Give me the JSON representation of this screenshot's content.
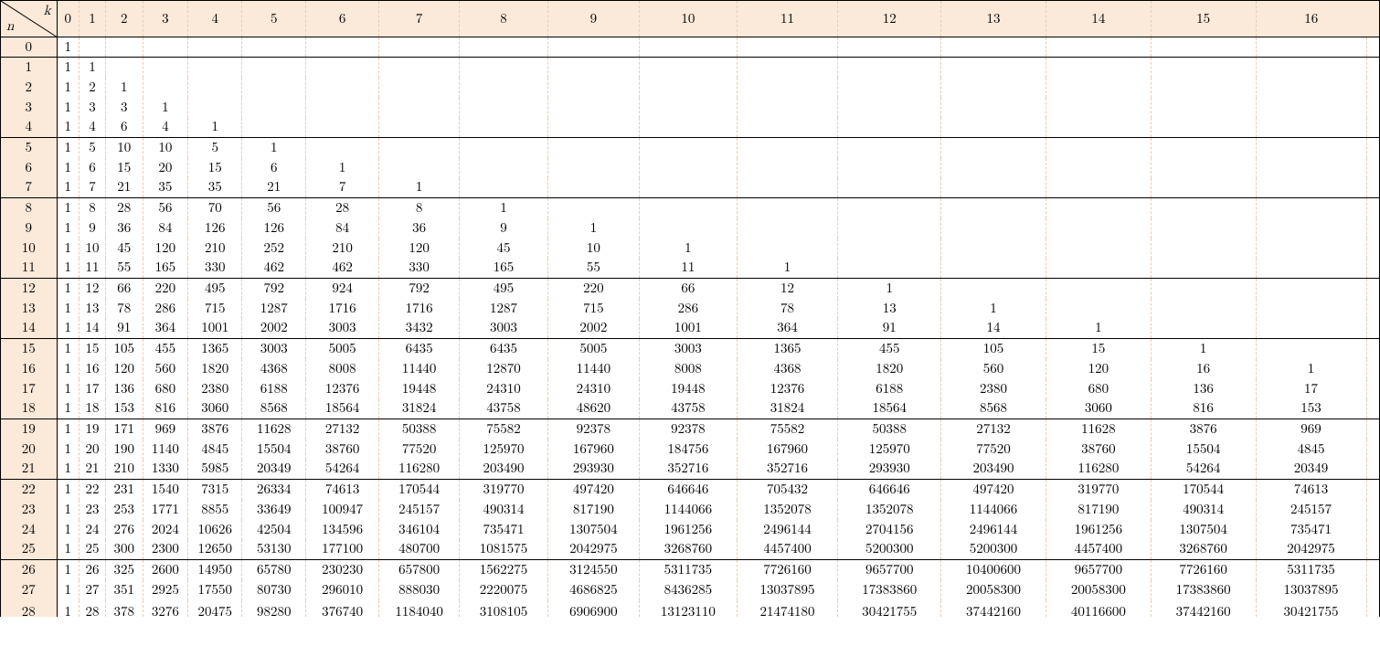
{
  "header": {
    "row_label": "n",
    "col_label": "k",
    "columns": [
      "0",
      "1",
      "2",
      "3",
      "4",
      "5",
      "6",
      "7",
      "8",
      "9",
      "10",
      "11",
      "12",
      "13",
      "14",
      "15",
      "16"
    ]
  },
  "rows": [
    {
      "n": "0",
      "sep": true,
      "cells": [
        "1",
        "",
        "",
        "",
        "",
        "",
        "",
        "",
        "",
        "",
        "",
        "",
        "",
        "",
        "",
        "",
        ""
      ]
    },
    {
      "n": "1",
      "sep": true,
      "cells": [
        "1",
        "1",
        "",
        "",
        "",
        "",
        "",
        "",
        "",
        "",
        "",
        "",
        "",
        "",
        "",
        "",
        ""
      ]
    },
    {
      "n": "2",
      "cells": [
        "1",
        "2",
        "1",
        "",
        "",
        "",
        "",
        "",
        "",
        "",
        "",
        "",
        "",
        "",
        "",
        "",
        ""
      ]
    },
    {
      "n": "3",
      "cells": [
        "1",
        "3",
        "3",
        "1",
        "",
        "",
        "",
        "",
        "",
        "",
        "",
        "",
        "",
        "",
        "",
        "",
        ""
      ]
    },
    {
      "n": "4",
      "cells": [
        "1",
        "4",
        "6",
        "4",
        "1",
        "",
        "",
        "",
        "",
        "",
        "",
        "",
        "",
        "",
        "",
        "",
        ""
      ]
    },
    {
      "n": "5",
      "sep": true,
      "cells": [
        "1",
        "5",
        "10",
        "10",
        "5",
        "1",
        "",
        "",
        "",
        "",
        "",
        "",
        "",
        "",
        "",
        "",
        ""
      ]
    },
    {
      "n": "6",
      "cells": [
        "1",
        "6",
        "15",
        "20",
        "15",
        "6",
        "1",
        "",
        "",
        "",
        "",
        "",
        "",
        "",
        "",
        "",
        ""
      ]
    },
    {
      "n": "7",
      "cells": [
        "1",
        "7",
        "21",
        "35",
        "35",
        "21",
        "7",
        "1",
        "",
        "",
        "",
        "",
        "",
        "",
        "",
        "",
        ""
      ]
    },
    {
      "n": "8",
      "sep": true,
      "cells": [
        "1",
        "8",
        "28",
        "56",
        "70",
        "56",
        "28",
        "8",
        "1",
        "",
        "",
        "",
        "",
        "",
        "",
        "",
        ""
      ]
    },
    {
      "n": "9",
      "cells": [
        "1",
        "9",
        "36",
        "84",
        "126",
        "126",
        "84",
        "36",
        "9",
        "1",
        "",
        "",
        "",
        "",
        "",
        "",
        ""
      ]
    },
    {
      "n": "10",
      "cells": [
        "1",
        "10",
        "45",
        "120",
        "210",
        "252",
        "210",
        "120",
        "45",
        "10",
        "1",
        "",
        "",
        "",
        "",
        "",
        ""
      ]
    },
    {
      "n": "11",
      "cells": [
        "1",
        "11",
        "55",
        "165",
        "330",
        "462",
        "462",
        "330",
        "165",
        "55",
        "11",
        "1",
        "",
        "",
        "",
        "",
        ""
      ]
    },
    {
      "n": "12",
      "sep": true,
      "cells": [
        "1",
        "12",
        "66",
        "220",
        "495",
        "792",
        "924",
        "792",
        "495",
        "220",
        "66",
        "12",
        "1",
        "",
        "",
        "",
        ""
      ]
    },
    {
      "n": "13",
      "cells": [
        "1",
        "13",
        "78",
        "286",
        "715",
        "1287",
        "1716",
        "1716",
        "1287",
        "715",
        "286",
        "78",
        "13",
        "1",
        "",
        "",
        ""
      ]
    },
    {
      "n": "14",
      "cells": [
        "1",
        "14",
        "91",
        "364",
        "1001",
        "2002",
        "3003",
        "3432",
        "3003",
        "2002",
        "1001",
        "364",
        "91",
        "14",
        "1",
        "",
        ""
      ]
    },
    {
      "n": "15",
      "sep": true,
      "cells": [
        "1",
        "15",
        "105",
        "455",
        "1365",
        "3003",
        "5005",
        "6435",
        "6435",
        "5005",
        "3003",
        "1365",
        "455",
        "105",
        "15",
        "1",
        ""
      ]
    },
    {
      "n": "16",
      "cells": [
        "1",
        "16",
        "120",
        "560",
        "1820",
        "4368",
        "8008",
        "11440",
        "12870",
        "11440",
        "8008",
        "4368",
        "1820",
        "560",
        "120",
        "16",
        "1"
      ]
    },
    {
      "n": "17",
      "cells": [
        "1",
        "17",
        "136",
        "680",
        "2380",
        "6188",
        "12376",
        "19448",
        "24310",
        "24310",
        "19448",
        "12376",
        "6188",
        "2380",
        "680",
        "136",
        "17"
      ]
    },
    {
      "n": "18",
      "cells": [
        "1",
        "18",
        "153",
        "816",
        "3060",
        "8568",
        "18564",
        "31824",
        "43758",
        "48620",
        "43758",
        "31824",
        "18564",
        "8568",
        "3060",
        "816",
        "153"
      ]
    },
    {
      "n": "19",
      "sep": true,
      "cells": [
        "1",
        "19",
        "171",
        "969",
        "3876",
        "11628",
        "27132",
        "50388",
        "75582",
        "92378",
        "92378",
        "75582",
        "50388",
        "27132",
        "11628",
        "3876",
        "969"
      ]
    },
    {
      "n": "20",
      "cells": [
        "1",
        "20",
        "190",
        "1140",
        "4845",
        "15504",
        "38760",
        "77520",
        "125970",
        "167960",
        "184756",
        "167960",
        "125970",
        "77520",
        "38760",
        "15504",
        "4845"
      ]
    },
    {
      "n": "21",
      "cells": [
        "1",
        "21",
        "210",
        "1330",
        "5985",
        "20349",
        "54264",
        "116280",
        "203490",
        "293930",
        "352716",
        "352716",
        "293930",
        "203490",
        "116280",
        "54264",
        "20349"
      ]
    },
    {
      "n": "22",
      "sep": true,
      "cells": [
        "1",
        "22",
        "231",
        "1540",
        "7315",
        "26334",
        "74613",
        "170544",
        "319770",
        "497420",
        "646646",
        "705432",
        "646646",
        "497420",
        "319770",
        "170544",
        "74613"
      ]
    },
    {
      "n": "23",
      "cells": [
        "1",
        "23",
        "253",
        "1771",
        "8855",
        "33649",
        "100947",
        "245157",
        "490314",
        "817190",
        "1144066",
        "1352078",
        "1352078",
        "1144066",
        "817190",
        "490314",
        "245157"
      ]
    },
    {
      "n": "24",
      "cells": [
        "1",
        "24",
        "276",
        "2024",
        "10626",
        "42504",
        "134596",
        "346104",
        "735471",
        "1307504",
        "1961256",
        "2496144",
        "2704156",
        "2496144",
        "1961256",
        "1307504",
        "735471"
      ]
    },
    {
      "n": "25",
      "cells": [
        "1",
        "25",
        "300",
        "2300",
        "12650",
        "53130",
        "177100",
        "480700",
        "1081575",
        "2042975",
        "3268760",
        "4457400",
        "5200300",
        "5200300",
        "4457400",
        "3268760",
        "2042975"
      ]
    },
    {
      "n": "26",
      "sep": true,
      "cells": [
        "1",
        "26",
        "325",
        "2600",
        "14950",
        "65780",
        "230230",
        "657800",
        "1562275",
        "3124550",
        "5311735",
        "7726160",
        "9657700",
        "10400600",
        "9657700",
        "7726160",
        "5311735"
      ]
    },
    {
      "n": "27",
      "cells": [
        "1",
        "27",
        "351",
        "2925",
        "17550",
        "80730",
        "296010",
        "888030",
        "2220075",
        "4686825",
        "8436285",
        "13037895",
        "17383860",
        "20058300",
        "20058300",
        "17383860",
        "13037895"
      ]
    },
    {
      "n": "28",
      "cut": true,
      "cells": [
        "1",
        "28",
        "378",
        "3276",
        "20475",
        "98280",
        "376740",
        "1184040",
        "3108105",
        "6906900",
        "13123110",
        "21474180",
        "30421755",
        "37442160",
        "40116600",
        "37442160",
        "30421755"
      ]
    }
  ],
  "chart_data": {
    "type": "table",
    "title": "Binomial coefficients C(n, k)",
    "row_axis": "n",
    "col_axis": "k",
    "columns": [
      0,
      1,
      2,
      3,
      4,
      5,
      6,
      7,
      8,
      9,
      10,
      11,
      12,
      13,
      14,
      15,
      16
    ],
    "rows": [
      {
        "n": 0,
        "values": [
          1
        ]
      },
      {
        "n": 1,
        "values": [
          1,
          1
        ]
      },
      {
        "n": 2,
        "values": [
          1,
          2,
          1
        ]
      },
      {
        "n": 3,
        "values": [
          1,
          3,
          3,
          1
        ]
      },
      {
        "n": 4,
        "values": [
          1,
          4,
          6,
          4,
          1
        ]
      },
      {
        "n": 5,
        "values": [
          1,
          5,
          10,
          10,
          5,
          1
        ]
      },
      {
        "n": 6,
        "values": [
          1,
          6,
          15,
          20,
          15,
          6,
          1
        ]
      },
      {
        "n": 7,
        "values": [
          1,
          7,
          21,
          35,
          35,
          21,
          7,
          1
        ]
      },
      {
        "n": 8,
        "values": [
          1,
          8,
          28,
          56,
          70,
          56,
          28,
          8,
          1
        ]
      },
      {
        "n": 9,
        "values": [
          1,
          9,
          36,
          84,
          126,
          126,
          84,
          36,
          9,
          1
        ]
      },
      {
        "n": 10,
        "values": [
          1,
          10,
          45,
          120,
          210,
          252,
          210,
          120,
          45,
          10,
          1
        ]
      },
      {
        "n": 11,
        "values": [
          1,
          11,
          55,
          165,
          330,
          462,
          462,
          330,
          165,
          55,
          11,
          1
        ]
      },
      {
        "n": 12,
        "values": [
          1,
          12,
          66,
          220,
          495,
          792,
          924,
          792,
          495,
          220,
          66,
          12,
          1
        ]
      },
      {
        "n": 13,
        "values": [
          1,
          13,
          78,
          286,
          715,
          1287,
          1716,
          1716,
          1287,
          715,
          286,
          78,
          13,
          1
        ]
      },
      {
        "n": 14,
        "values": [
          1,
          14,
          91,
          364,
          1001,
          2002,
          3003,
          3432,
          3003,
          2002,
          1001,
          364,
          91,
          14,
          1
        ]
      },
      {
        "n": 15,
        "values": [
          1,
          15,
          105,
          455,
          1365,
          3003,
          5005,
          6435,
          6435,
          5005,
          3003,
          1365,
          455,
          105,
          15,
          1
        ]
      },
      {
        "n": 16,
        "values": [
          1,
          16,
          120,
          560,
          1820,
          4368,
          8008,
          11440,
          12870,
          11440,
          8008,
          4368,
          1820,
          560,
          120,
          16,
          1
        ]
      },
      {
        "n": 17,
        "values": [
          1,
          17,
          136,
          680,
          2380,
          6188,
          12376,
          19448,
          24310,
          24310,
          19448,
          12376,
          6188,
          2380,
          680,
          136,
          17
        ]
      },
      {
        "n": 18,
        "values": [
          1,
          18,
          153,
          816,
          3060,
          8568,
          18564,
          31824,
          43758,
          48620,
          43758,
          31824,
          18564,
          8568,
          3060,
          816,
          153
        ]
      },
      {
        "n": 19,
        "values": [
          1,
          19,
          171,
          969,
          3876,
          11628,
          27132,
          50388,
          75582,
          92378,
          92378,
          75582,
          50388,
          27132,
          11628,
          3876,
          969
        ]
      },
      {
        "n": 20,
        "values": [
          1,
          20,
          190,
          1140,
          4845,
          15504,
          38760,
          77520,
          125970,
          167960,
          184756,
          167960,
          125970,
          77520,
          38760,
          15504,
          4845
        ]
      },
      {
        "n": 21,
        "values": [
          1,
          21,
          210,
          1330,
          5985,
          20349,
          54264,
          116280,
          203490,
          293930,
          352716,
          352716,
          293930,
          203490,
          116280,
          54264,
          20349
        ]
      },
      {
        "n": 22,
        "values": [
          1,
          22,
          231,
          1540,
          7315,
          26334,
          74613,
          170544,
          319770,
          497420,
          646646,
          705432,
          646646,
          497420,
          319770,
          170544,
          74613
        ]
      },
      {
        "n": 23,
        "values": [
          1,
          23,
          253,
          1771,
          8855,
          33649,
          100947,
          245157,
          490314,
          817190,
          1144066,
          1352078,
          1352078,
          1144066,
          817190,
          490314,
          245157
        ]
      },
      {
        "n": 24,
        "values": [
          1,
          24,
          276,
          2024,
          10626,
          42504,
          134596,
          346104,
          735471,
          1307504,
          1961256,
          2496144,
          2704156,
          2496144,
          1961256,
          1307504,
          735471
        ]
      },
      {
        "n": 25,
        "values": [
          1,
          25,
          300,
          2300,
          12650,
          53130,
          177100,
          480700,
          1081575,
          2042975,
          3268760,
          4457400,
          5200300,
          5200300,
          4457400,
          3268760,
          2042975
        ]
      },
      {
        "n": 26,
        "values": [
          1,
          26,
          325,
          2600,
          14950,
          65780,
          230230,
          657800,
          1562275,
          3124550,
          5311735,
          7726160,
          9657700,
          10400600,
          9657700,
          7726160,
          5311735
        ]
      },
      {
        "n": 27,
        "values": [
          1,
          27,
          351,
          2925,
          17550,
          80730,
          296010,
          888030,
          2220075,
          4686825,
          8436285,
          13037895,
          17383860,
          20058300,
          20058300,
          17383860,
          13037895
        ]
      },
      {
        "n": 28,
        "values": [
          1,
          28,
          378,
          3276,
          20475,
          98280,
          376740,
          1184040,
          3108105,
          6906900,
          13123110,
          21474180,
          30421755,
          37442160,
          40116600,
          37442160,
          30421755
        ]
      }
    ]
  }
}
